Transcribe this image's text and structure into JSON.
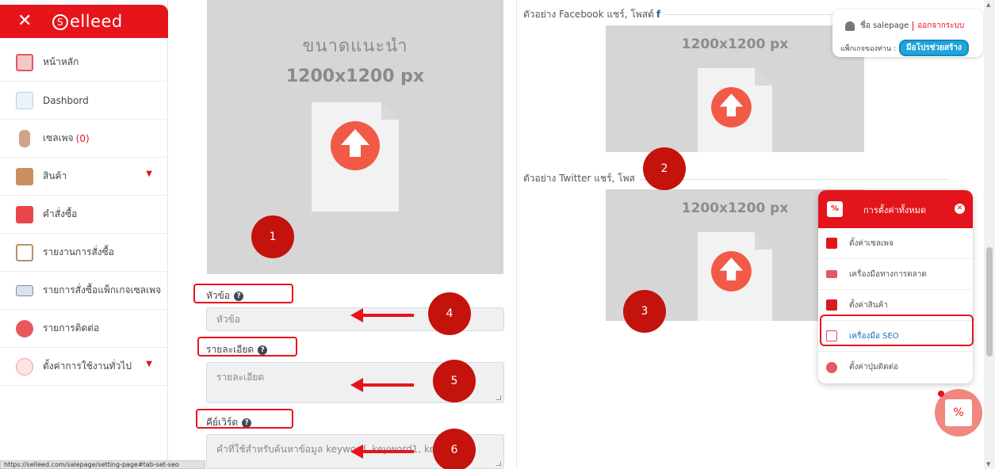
{
  "brand": {
    "logo_text": "elleed",
    "logo_mark": "S"
  },
  "sidebar": {
    "items": [
      {
        "label": "หน้าหลัก"
      },
      {
        "label": "Dashbord"
      },
      {
        "label": "เซลเพจ",
        "count": "(0)"
      },
      {
        "label": "สินค้า"
      },
      {
        "label": "คำสั่งซื้อ"
      },
      {
        "label": "รายงานการสั่งซื้อ"
      },
      {
        "label": "รายการสั่งซื้อแพ็กเกจเซลเพจ"
      },
      {
        "label": "รายการติดต่อ"
      },
      {
        "label": "ตั้งค่าการใช้งานทั่วไป"
      }
    ]
  },
  "main_upload": {
    "line1": "ขนาดแนะนำ",
    "line2": "1200x1200 px"
  },
  "form": {
    "title_label": "หัวข้อ",
    "title_placeholder": "หัวข้อ",
    "detail_label": "รายละเอียด",
    "detail_placeholder": "รายละเอียด",
    "keyword_label": "คีย์เวิร์ด",
    "keyword_placeholder": "คำที่ใช้สำหรับค้นหาข้อมูล keyword, keyword1, ke"
  },
  "facebook_preview": {
    "title": "ตัวอย่าง Facebook แชร์, โพสต์",
    "fb_glyph": "f",
    "size": "1200x1200 px"
  },
  "twitter_preview": {
    "title": "ตัวอย่าง Twitter แชร์, โพส",
    "size": "1200x1200 px"
  },
  "markers": [
    "1",
    "2",
    "3",
    "4",
    "5",
    "6"
  ],
  "user_panel": {
    "name": "ชื่อ salepage",
    "logout": "ออกจากระบบ",
    "package_label": "แพ็กเกจของท่าน :",
    "package_name": "มือโปรช่วยสร้าง"
  },
  "settings_popup": {
    "title": "การตั้งค่าทั้งหมด",
    "items": [
      {
        "label": "ตั้งค่าเซลเพจ",
        "icon": "store-icon"
      },
      {
        "label": "เครื่องมือทางการตลาด",
        "icon": "cart-icon"
      },
      {
        "label": "ตั้งค่าสินค้า",
        "icon": "box-icon"
      },
      {
        "label": "เครื่องมือ SEO",
        "icon": "seo-icon"
      },
      {
        "label": "ตั้งค่าปุ่มติดต่อ",
        "icon": "contact-button-icon"
      }
    ]
  },
  "status_url": "https://selleed.com/salepage/setting-page#tab-set-seo",
  "colors": {
    "brand_red": "#e7141b",
    "upload_gray": "#d6d6d6",
    "upload_arrow": "#f15a47",
    "badge_blue": "#1fa4db"
  }
}
